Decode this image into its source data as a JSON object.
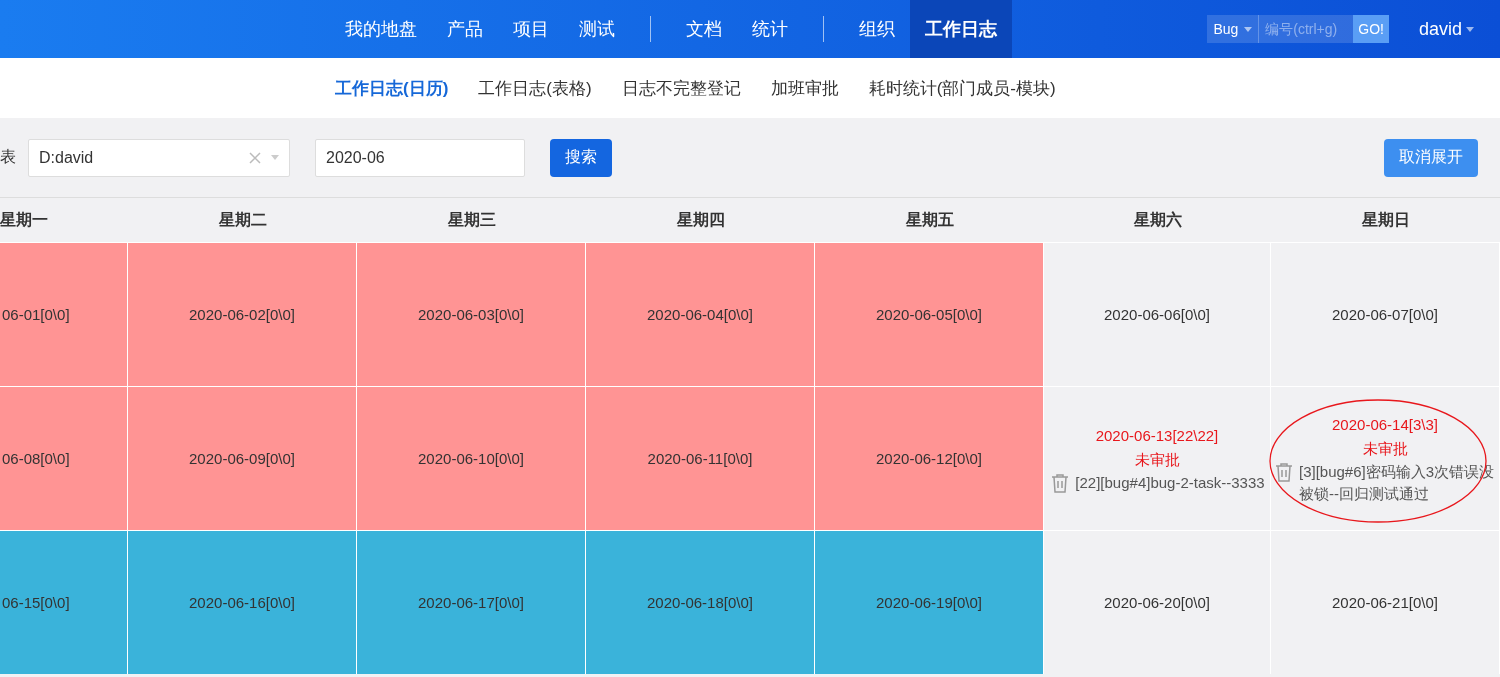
{
  "top_nav": {
    "items": [
      {
        "kind": "item",
        "label": "我的地盘",
        "selected": false
      },
      {
        "kind": "item",
        "label": "产品",
        "selected": false
      },
      {
        "kind": "item",
        "label": "项目",
        "selected": false
      },
      {
        "kind": "item",
        "label": "测试",
        "selected": false
      },
      {
        "kind": "separator"
      },
      {
        "kind": "item",
        "label": "文档",
        "selected": false
      },
      {
        "kind": "item",
        "label": "统计",
        "selected": false
      },
      {
        "kind": "separator"
      },
      {
        "kind": "item",
        "label": "组织",
        "selected": false
      },
      {
        "kind": "item",
        "label": "工作日志",
        "selected": true
      }
    ],
    "search": {
      "type": "Bug",
      "placeholder": "编号(ctrl+g)",
      "button": "GO!"
    },
    "user": "david"
  },
  "sub_nav": [
    {
      "label": "工作日志(日历)",
      "selected": true
    },
    {
      "label": "工作日志(表格)",
      "selected": false
    },
    {
      "label": "日志不完整登记",
      "selected": false
    },
    {
      "label": "加班审批",
      "selected": false
    },
    {
      "label": "耗时统计(部门成员-模块)",
      "selected": false
    }
  ],
  "filter": {
    "label": "表",
    "user_select": "D:david",
    "month": "2020-06",
    "search_button": "搜索",
    "collapse_button": "取消展开"
  },
  "calendar": {
    "columns": [
      "星期一",
      "星期二",
      "星期三",
      "星期四",
      "星期五",
      "星期六",
      "星期日"
    ],
    "weeks": [
      [
        {
          "kind": "missing",
          "date": "06-01[0\\0]"
        },
        {
          "kind": "missing",
          "date": "2020-06-02[0\\0]"
        },
        {
          "kind": "missing",
          "date": "2020-06-03[0\\0]"
        },
        {
          "kind": "missing",
          "date": "2020-06-04[0\\0]"
        },
        {
          "kind": "missing",
          "date": "2020-06-05[0\\0]"
        },
        {
          "kind": "weekend",
          "date": "2020-06-06[0\\0]"
        },
        {
          "kind": "weekend",
          "date": "2020-06-07[0\\0]"
        }
      ],
      [
        {
          "kind": "missing",
          "date": "06-08[0\\0]"
        },
        {
          "kind": "missing",
          "date": "2020-06-09[0\\0]"
        },
        {
          "kind": "missing",
          "date": "2020-06-10[0\\0]"
        },
        {
          "kind": "missing",
          "date": "2020-06-11[0\\0]"
        },
        {
          "kind": "missing",
          "date": "2020-06-12[0\\0]"
        },
        {
          "kind": "weekend",
          "date": "2020-06-13[22\\22]",
          "pending": true,
          "status": "未审批",
          "entries": [
            "[22][bug#4]bug-2-task--3333"
          ]
        },
        {
          "kind": "weekend",
          "date": "2020-06-14[3\\3]",
          "pending": true,
          "status": "未审批",
          "circled": true,
          "entries": [
            "[3][bug#6]密码输入3次错误没被锁--回归测试通过"
          ]
        }
      ],
      [
        {
          "kind": "future",
          "date": "06-15[0\\0]"
        },
        {
          "kind": "future",
          "date": "2020-06-16[0\\0]"
        },
        {
          "kind": "future",
          "date": "2020-06-17[0\\0]"
        },
        {
          "kind": "future",
          "date": "2020-06-18[0\\0]"
        },
        {
          "kind": "future",
          "date": "2020-06-19[0\\0]"
        },
        {
          "kind": "weekend",
          "date": "2020-06-20[0\\0]"
        },
        {
          "kind": "weekend",
          "date": "2020-06-21[0\\0]"
        }
      ]
    ]
  }
}
